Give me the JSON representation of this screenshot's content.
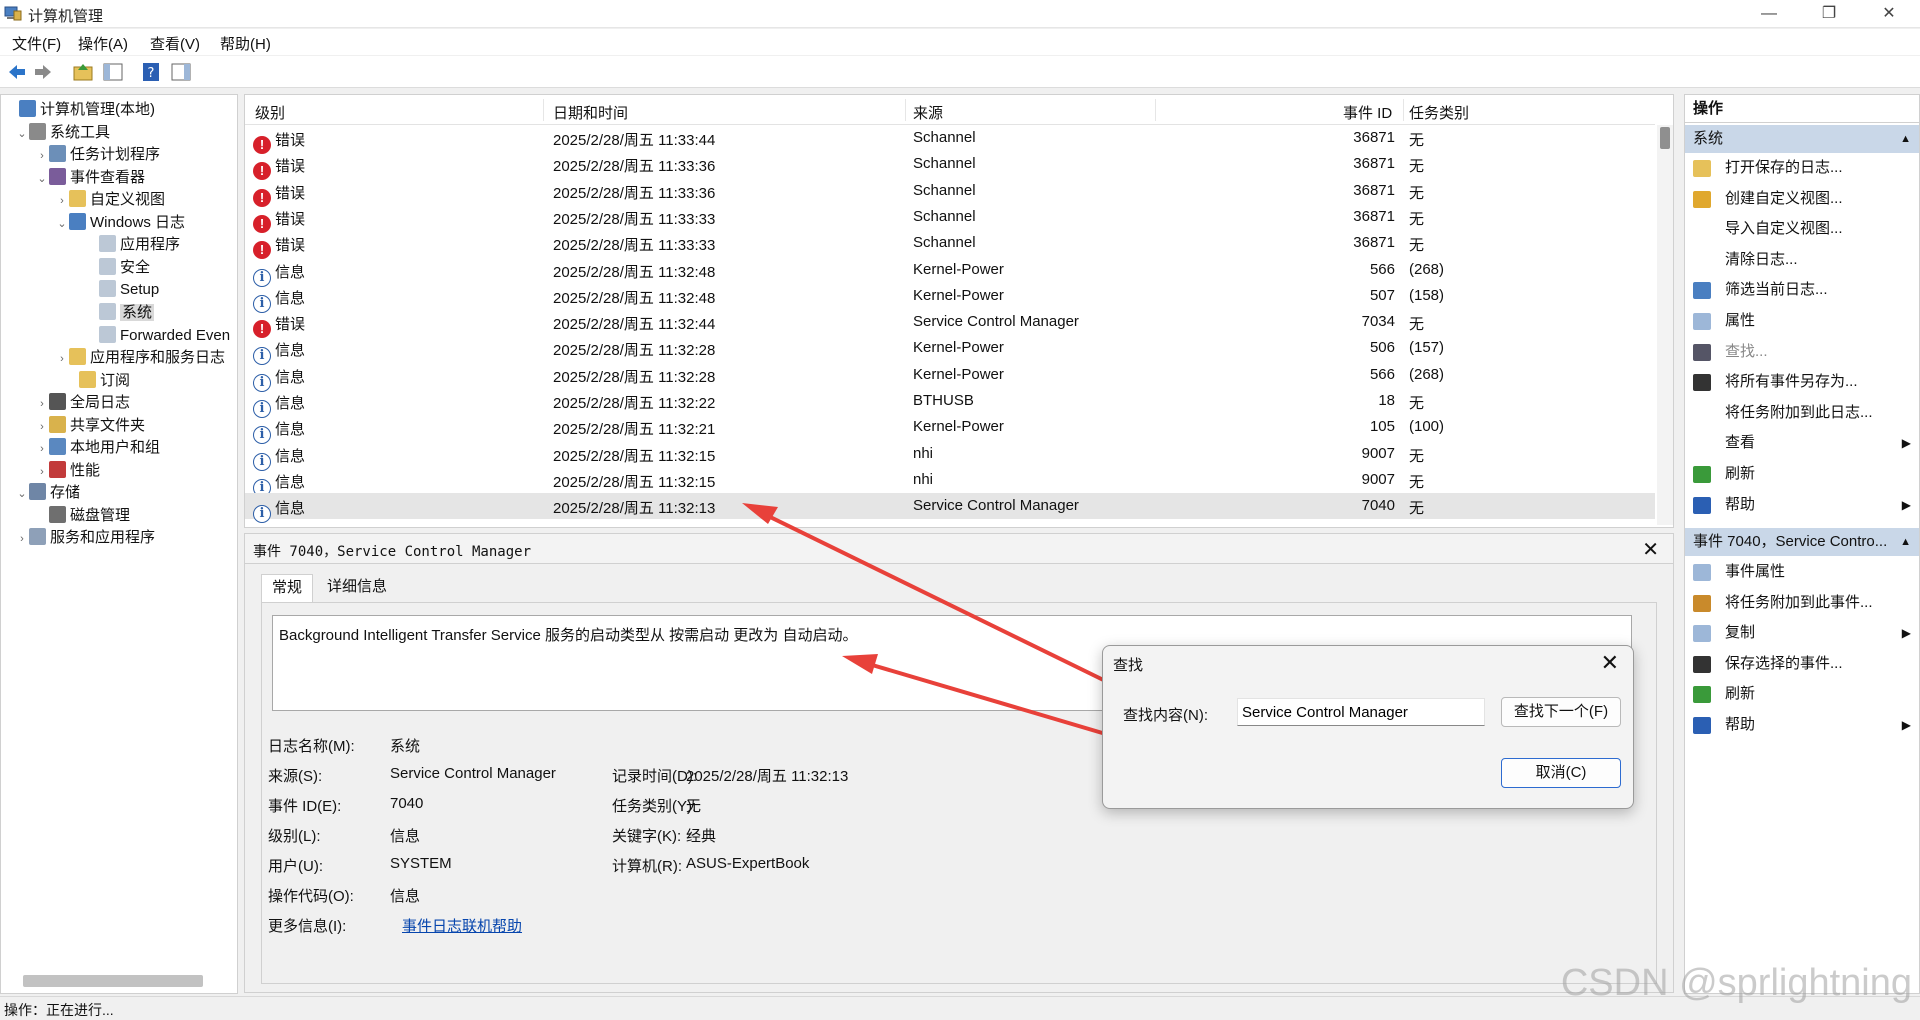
{
  "window": {
    "title": "计算机管理",
    "controls": [
      "minimize-icon",
      "restore-icon",
      "close-icon"
    ]
  },
  "menu": [
    "文件(F)",
    "操作(A)",
    "查看(V)",
    "帮助(H)"
  ],
  "toolbar": [
    "back-arrow-icon",
    "forward-arrow-icon",
    "up-folder-icon",
    "show-hide-tree-icon",
    "help-icon",
    "show-hide-action-icon"
  ],
  "tree": [
    {
      "label": "计算机管理(本地)",
      "exp": "",
      "icon": "computer-management-icon"
    },
    {
      "label": "系统工具",
      "exp": "⌄",
      "icon": "system-tools-icon"
    },
    {
      "label": "任务计划程序",
      "exp": "›",
      "icon": "task-scheduler-icon"
    },
    {
      "label": "事件查看器",
      "exp": "⌄",
      "icon": "event-viewer-icon"
    },
    {
      "label": "自定义视图",
      "exp": "›",
      "icon": "folder-icon"
    },
    {
      "label": "Windows 日志",
      "exp": "⌄",
      "icon": "windows-logs-icon"
    },
    {
      "label": "应用程序",
      "exp": "",
      "icon": "log-icon"
    },
    {
      "label": "安全",
      "exp": "",
      "icon": "log-icon"
    },
    {
      "label": "Setup",
      "exp": "",
      "icon": "log-icon"
    },
    {
      "label": "系统",
      "exp": "",
      "icon": "log-icon"
    },
    {
      "label": "Forwarded Even",
      "exp": "",
      "icon": "log-icon"
    },
    {
      "label": "应用程序和服务日志",
      "exp": "›",
      "icon": "folder-icon"
    },
    {
      "label": "订阅",
      "exp": "",
      "icon": "subscription-icon"
    },
    {
      "label": "全局日志",
      "exp": "›",
      "icon": "global-logs-icon"
    },
    {
      "label": "共享文件夹",
      "exp": "›",
      "icon": "shared-folders-icon"
    },
    {
      "label": "本地用户和组",
      "exp": "›",
      "icon": "users-icon"
    },
    {
      "label": "性能",
      "exp": "›",
      "icon": "performance-icon"
    },
    {
      "label": "存储",
      "exp": "⌄",
      "icon": "storage-icon"
    },
    {
      "label": "磁盘管理",
      "exp": "",
      "icon": "disk-management-icon"
    },
    {
      "label": "服务和应用程序",
      "exp": "›",
      "icon": "services-icon"
    }
  ],
  "list": {
    "columns": [
      "级别",
      "日期和时间",
      "来源",
      "事件 ID",
      "任务类别"
    ],
    "rows": [
      {
        "level": "错误",
        "type": "error",
        "datetime": "2025/2/28/周五 11:33:44",
        "source": "Schannel",
        "id": "36871",
        "task": "无"
      },
      {
        "level": "错误",
        "type": "error",
        "datetime": "2025/2/28/周五 11:33:36",
        "source": "Schannel",
        "id": "36871",
        "task": "无"
      },
      {
        "level": "错误",
        "type": "error",
        "datetime": "2025/2/28/周五 11:33:36",
        "source": "Schannel",
        "id": "36871",
        "task": "无"
      },
      {
        "level": "错误",
        "type": "error",
        "datetime": "2025/2/28/周五 11:33:33",
        "source": "Schannel",
        "id": "36871",
        "task": "无"
      },
      {
        "level": "错误",
        "type": "error",
        "datetime": "2025/2/28/周五 11:33:33",
        "source": "Schannel",
        "id": "36871",
        "task": "无"
      },
      {
        "level": "信息",
        "type": "info",
        "datetime": "2025/2/28/周五 11:32:48",
        "source": "Kernel-Power",
        "id": "566",
        "task": "(268)"
      },
      {
        "level": "信息",
        "type": "info",
        "datetime": "2025/2/28/周五 11:32:48",
        "source": "Kernel-Power",
        "id": "507",
        "task": "(158)"
      },
      {
        "level": "错误",
        "type": "error",
        "datetime": "2025/2/28/周五 11:32:44",
        "source": "Service Control Manager",
        "id": "7034",
        "task": "无"
      },
      {
        "level": "信息",
        "type": "info",
        "datetime": "2025/2/28/周五 11:32:28",
        "source": "Kernel-Power",
        "id": "506",
        "task": "(157)"
      },
      {
        "level": "信息",
        "type": "info",
        "datetime": "2025/2/28/周五 11:32:28",
        "source": "Kernel-Power",
        "id": "566",
        "task": "(268)"
      },
      {
        "level": "信息",
        "type": "info",
        "datetime": "2025/2/28/周五 11:32:22",
        "source": "BTHUSB",
        "id": "18",
        "task": "无"
      },
      {
        "level": "信息",
        "type": "info",
        "datetime": "2025/2/28/周五 11:32:21",
        "source": "Kernel-Power",
        "id": "105",
        "task": "(100)"
      },
      {
        "level": "信息",
        "type": "info",
        "datetime": "2025/2/28/周五 11:32:15",
        "source": "nhi",
        "id": "9007",
        "task": "无"
      },
      {
        "level": "信息",
        "type": "info",
        "datetime": "2025/2/28/周五 11:32:15",
        "source": "nhi",
        "id": "9007",
        "task": "无"
      },
      {
        "level": "信息",
        "type": "info",
        "datetime": "2025/2/28/周五 11:32:13",
        "source": "Service Control Manager",
        "id": "7040",
        "task": "无"
      }
    ]
  },
  "detail": {
    "title": "事件 7040，Service Control Manager",
    "tabs": [
      "常规",
      "详细信息"
    ],
    "message": "Background Intelligent Transfer Service 服务的启动类型从 按需启动 更改为 自动启动。",
    "labels": {
      "log_name": "日志名称(M):",
      "source": "来源(S):",
      "event_id": "事件 ID(E):",
      "level": "级别(L):",
      "user": "用户(U):",
      "opcode": "操作代码(O):",
      "more_info": "更多信息(I):",
      "logged": "记录时间(D):",
      "task": "任务类别(Y):",
      "keywords": "关键字(K):",
      "computer": "计算机(R):"
    },
    "values": {
      "log_name": "系统",
      "source": "Service Control Manager",
      "event_id": "7040",
      "level": "信息",
      "user": "SYSTEM",
      "opcode": "信息",
      "more_info": "事件日志联机帮助",
      "logged": "2025/2/28/周五 11:32:13",
      "task": "无",
      "keywords": "经典",
      "computer": "ASUS-ExpertBook"
    }
  },
  "actions": {
    "title": "操作",
    "section1": "系统",
    "items1": [
      {
        "label": "打开保存的日志...",
        "icon": "open-folder-icon",
        "sub": ""
      },
      {
        "label": "创建自定义视图...",
        "icon": "filter-create-icon",
        "sub": ""
      },
      {
        "label": "导入自定义视图...",
        "icon": "",
        "sub": ""
      },
      {
        "label": "清除日志...",
        "icon": "",
        "sub": ""
      },
      {
        "label": "筛选当前日志...",
        "icon": "filter-icon",
        "sub": ""
      },
      {
        "label": "属性",
        "icon": "properties-icon",
        "sub": ""
      },
      {
        "label": "查找...",
        "icon": "binoculars-icon",
        "sub": "",
        "disabled": true
      },
      {
        "label": "将所有事件另存为...",
        "icon": "save-icon",
        "sub": ""
      },
      {
        "label": "将任务附加到此日志...",
        "icon": "",
        "sub": ""
      },
      {
        "label": "查看",
        "icon": "",
        "sub": "▶"
      },
      {
        "label": "刷新",
        "icon": "refresh-icon",
        "sub": ""
      },
      {
        "label": "帮助",
        "icon": "help-icon",
        "sub": "▶"
      }
    ],
    "section2": "事件 7040，Service Contro...",
    "items2": [
      {
        "label": "事件属性",
        "icon": "properties-icon",
        "sub": ""
      },
      {
        "label": "将任务附加到此事件...",
        "icon": "task-clock-icon",
        "sub": ""
      },
      {
        "label": "复制",
        "icon": "copy-icon",
        "sub": "▶"
      },
      {
        "label": "保存选择的事件...",
        "icon": "save-icon",
        "sub": ""
      },
      {
        "label": "刷新",
        "icon": "refresh-icon",
        "sub": ""
      },
      {
        "label": "帮助",
        "icon": "help-icon",
        "sub": "▶"
      }
    ]
  },
  "status": "操作：正在进行...",
  "find_dialog": {
    "title": "查找",
    "label": "查找内容(N):",
    "value": "Service Control Manager",
    "find_next": "查找下一个(F)",
    "cancel": "取消(C)"
  },
  "watermark": "CSDN @sprlightning",
  "colors": {
    "error": "#d7202a",
    "info": "#2d5fa8",
    "annotation_arrow": "#e8413a",
    "section_header": "#c9d7e8",
    "link": "#0645ad"
  }
}
